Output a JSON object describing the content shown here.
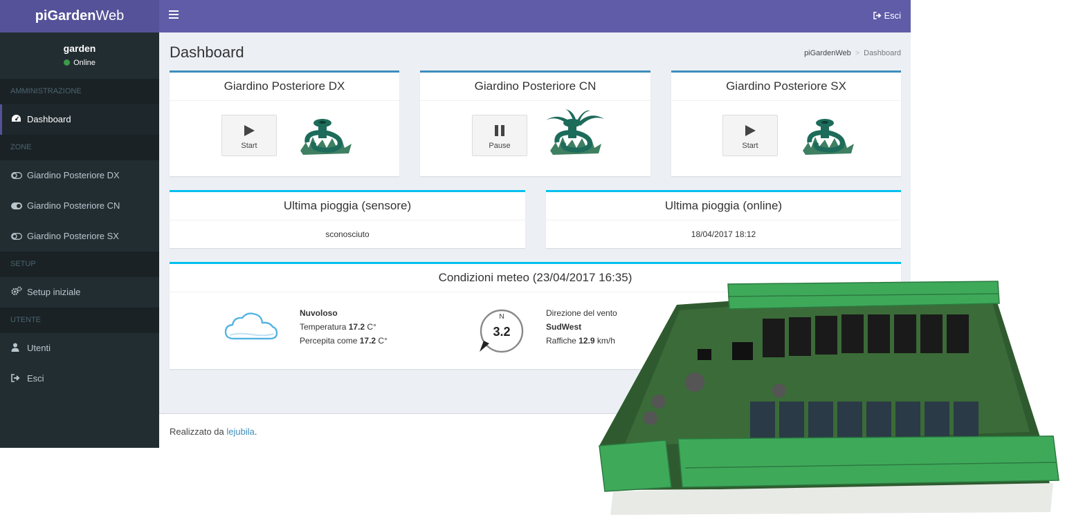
{
  "app": {
    "title_bold": "piGarden",
    "title_rest": "Web"
  },
  "user": {
    "name": "garden",
    "status": "Online"
  },
  "sidebar": {
    "sections": [
      {
        "header": "AMMINISTRAZIONE",
        "items": [
          {
            "label": "Dashboard",
            "icon": "dashboard-icon",
            "active": true
          }
        ]
      },
      {
        "header": "ZONE",
        "items": [
          {
            "label": "Giardino Posteriore DX",
            "icon": "toggle-off-icon"
          },
          {
            "label": "Giardino Posteriore CN",
            "icon": "toggle-on-icon"
          },
          {
            "label": "Giardino Posteriore SX",
            "icon": "toggle-off-icon"
          }
        ]
      },
      {
        "header": "SETUP",
        "items": [
          {
            "label": "Setup iniziale",
            "icon": "gears-icon"
          }
        ]
      },
      {
        "header": "UTENTE",
        "items": [
          {
            "label": "Utenti",
            "icon": "user-icon"
          },
          {
            "label": "Esci",
            "icon": "sign-out-icon"
          }
        ]
      }
    ]
  },
  "header": {
    "logout_label": "Esci"
  },
  "page": {
    "title": "Dashboard",
    "breadcrumb": [
      "piGardenWeb",
      "Dashboard"
    ]
  },
  "zones": [
    {
      "title": "Giardino Posteriore DX",
      "button": "Start",
      "state": "stopped"
    },
    {
      "title": "Giardino Posteriore CN",
      "button": "Pause",
      "state": "running"
    },
    {
      "title": "Giardino Posteriore SX",
      "button": "Start",
      "state": "stopped"
    }
  ],
  "rain": {
    "sensor": {
      "title": "Ultima pioggia (sensore)",
      "value": "sconosciuto"
    },
    "online": {
      "title": "Ultima pioggia (online)",
      "value": "18/04/2017 18:12"
    }
  },
  "weather": {
    "title": "Condizioni meteo (23/04/2017 16:35)",
    "condition": "Nuvoloso",
    "temp_label": "Temperatura",
    "temp_value": "17.2",
    "feels_label": "Percepita come",
    "feels_value": "17.2",
    "temp_unit": "C°",
    "compass_n": "N",
    "wind_speed": "3.2",
    "wind_dir_label": "Direzione del vento",
    "wind_dir": "SudWest",
    "gust_label": "Raffiche",
    "gust_value": "12.9",
    "gust_unit": "km/h"
  },
  "footer": {
    "prefix": "Realizzato da",
    "link": "lejubila",
    "suffix": "."
  }
}
